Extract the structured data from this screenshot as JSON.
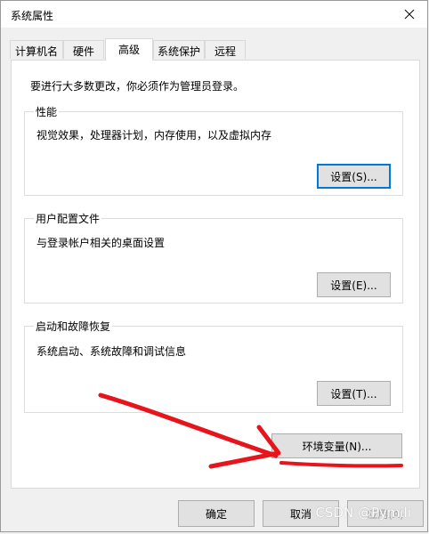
{
  "window": {
    "title": "系统属性"
  },
  "tabs": [
    {
      "label": "计算机名"
    },
    {
      "label": "硬件"
    },
    {
      "label": "高级"
    },
    {
      "label": "系统保护"
    },
    {
      "label": "远程"
    }
  ],
  "intro": "要进行大多数更改，你必须作为管理员登录。",
  "groups": {
    "performance": {
      "label": "性能",
      "desc": "视觉效果，处理器计划，内存使用，以及虚拟内存",
      "button": "设置(S)..."
    },
    "user_profiles": {
      "label": "用户配置文件",
      "desc": "与登录帐户相关的桌面设置",
      "button": "设置(E)..."
    },
    "startup_recovery": {
      "label": "启动和故障恢复",
      "desc": "系统启动、系统故障和调试信息",
      "button": "设置(T)..."
    }
  },
  "env_button": "环境变量(N)...",
  "footer": {
    "ok": "确定",
    "cancel": "取消",
    "apply": "应用(A)"
  },
  "watermark": "CSDN @Pymili",
  "colors": {
    "annotation": "#e8141c",
    "focus": "#0078d7"
  },
  "icons": {
    "close": "close-icon"
  }
}
